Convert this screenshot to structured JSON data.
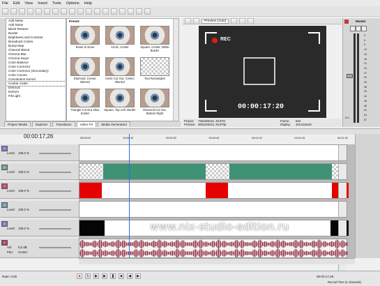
{
  "menu": [
    "File",
    "Edit",
    "View",
    "Insert",
    "Tools",
    "Options",
    "Help"
  ],
  "effects_list": [
    "Add Noise",
    "Add Noise",
    "Black Restore",
    "Border",
    "Brightness and Contrast",
    "Broadcast Colors",
    "Bump Map",
    "Channel Blend",
    "Chroma Blur",
    "Chroma Keyer",
    "Color Balance",
    "Color Corrector",
    "Color Corrector (Secondary)",
    "Color Curves",
    "Convolution Kernel",
    "Cookie Cutter",
    "Defocus",
    "Deform",
    "Fill Light"
  ],
  "effects_selected": "Cookie Cutter",
  "presets_title": "Preset:",
  "presets": [
    {
      "label": "Reset to None",
      "style": "eye"
    },
    {
      "label": "Circle, Center",
      "style": "eye"
    },
    {
      "label": "Square, Center, White Border",
      "style": "eye"
    },
    {
      "label": "Diamond, Center, Blurred",
      "style": "eye"
    },
    {
      "label": "Circle Cut Out, Center, Blurred",
      "style": "eye"
    },
    {
      "label": "Two Rectangles",
      "style": "checker"
    },
    {
      "label": "Triangle Cut Out, Blue border",
      "style": "eye"
    },
    {
      "label": "Square, Top Left, Border",
      "style": "eye"
    },
    {
      "label": "Diamond Cut Out, Bottom Right",
      "style": "eye"
    }
  ],
  "tabs": [
    "Project Media",
    "Explorer",
    "Transitions",
    "Video FX",
    "Media Generators"
  ],
  "active_tab": "Video FX",
  "preview": {
    "quality": "Preview (Auto)",
    "rec": "REC",
    "timecode": "00:00:17:20",
    "info_left": [
      "Project:",
      "Preview:",
      "Frame:",
      "Display:"
    ],
    "info_values": [
      "720x480x32, 29,970i",
      "360x240x32, 29,970p",
      "533",
      "401x316x32"
    ]
  },
  "mixer": {
    "title": "Master",
    "scale": [
      "3",
      "6",
      "9",
      "12",
      "15",
      "18",
      "21",
      "24",
      "27",
      "30",
      "33",
      "36",
      "39",
      "42",
      "45",
      "48",
      "51",
      "54",
      "57"
    ],
    "value": "0,0"
  },
  "timeline": {
    "current_time": "00:00:17,26",
    "ruler": [
      "00:00:00",
      "00:00:15",
      "00:00:30",
      "00:00:45",
      "00:01:00",
      "00:01:15",
      "00:01:30"
    ],
    "tracks": [
      {
        "num": "1",
        "label": "Level:",
        "value": "100,0 %"
      },
      {
        "num": "2",
        "label": "Level:",
        "value": "100,0 %"
      },
      {
        "num": "3",
        "label": "Level:",
        "value": "100,0 %"
      },
      {
        "num": "4",
        "label": "Level:",
        "value": "100,0 %"
      },
      {
        "num": "5",
        "label": "Level:",
        "value": "100,0 %"
      },
      {
        "num": "6",
        "label": "Vol:",
        "value": "0,0 dB",
        "label2": "Pan:",
        "value2": "Center"
      }
    ],
    "end_time": "00:00:17,26"
  },
  "status": {
    "rate": "Rate: 0,00",
    "right": "Record Time (2 channels)"
  },
  "watermark": "www.nix-studio-edition.ru",
  "colors": {
    "green_clip": "#3f9273",
    "red_clip": "#e60000",
    "audio_wave": "#8b2438",
    "playhead": "#2c6fd6"
  }
}
